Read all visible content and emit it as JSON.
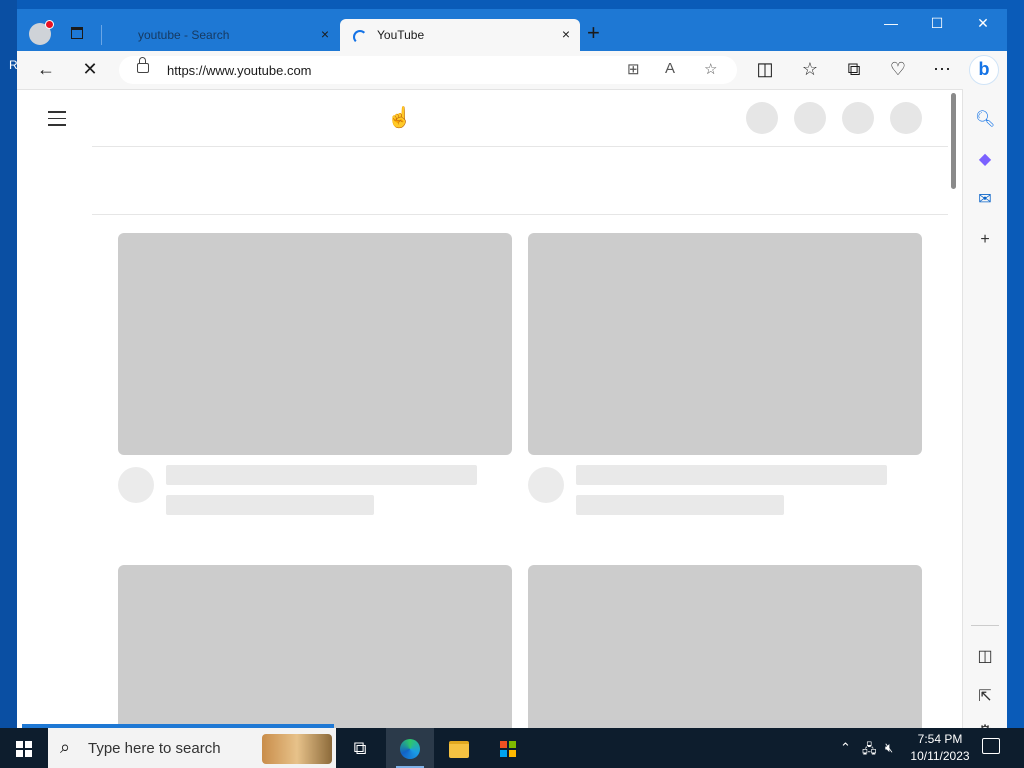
{
  "desktop": {
    "edge_letter": "R"
  },
  "browser": {
    "tabs": [
      {
        "title": "youtube - Search",
        "close": "×"
      },
      {
        "title": "YouTube",
        "close": "×"
      }
    ],
    "new_tab": "+",
    "window_controls": {
      "minimize": "—",
      "maximize": "☐",
      "close": "✕"
    },
    "address_bar": {
      "url": "https://www.youtube.com"
    },
    "toolbar_icons": [
      "back-icon",
      "stop-icon",
      "app-available-icon",
      "read-aloud-icon",
      "favorite-star-icon",
      "split-screen-icon",
      "favorites-icon",
      "collections-icon",
      "browser-essentials-icon",
      "more-icon",
      "bing-icon"
    ],
    "sidebar_icons": [
      "search-icon",
      "office-icon",
      "outlook-icon",
      "add-icon",
      "hide-sidebar-icon",
      "open-external-icon",
      "settings-icon"
    ]
  },
  "page": {
    "state": "loading-skeleton"
  },
  "taskbar": {
    "search_placeholder": "Type here to search",
    "time": "7:54 PM",
    "date": "10/11/2023"
  },
  "colors": {
    "tabstrip": "#1e78d4",
    "taskbar": "#0d1d2d",
    "skeleton_thumb": "#cccccc",
    "skeleton_line": "#e9e9e9"
  }
}
